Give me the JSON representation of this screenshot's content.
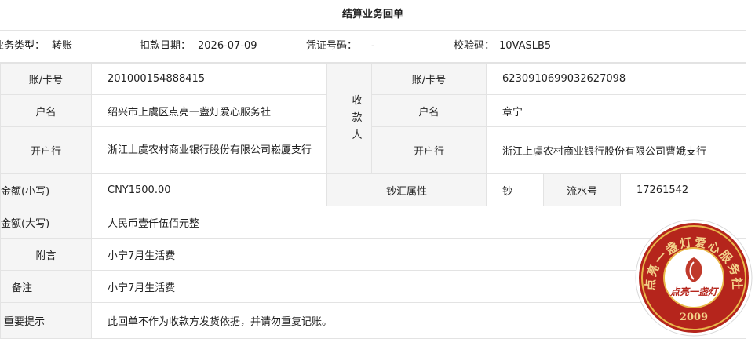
{
  "title": "结算业务回单",
  "meta": {
    "type_label": "业务类型：",
    "type_value": "转账",
    "date_label": "扣款日期：",
    "date_value": "2026-07-09",
    "voucher_label": "凭证号码：",
    "voucher_value": "-",
    "check_label": "校验码：",
    "check_value": "10VASLB5"
  },
  "payer": {
    "account_label": "账/卡号",
    "account_value": "201000154888415",
    "name_label": "户名",
    "name_value": "绍兴市上虞区点亮一盏灯爱心服务社",
    "bank_label": "开户行",
    "bank_value": "浙江上虞农村商业银行股份有限公司崧厦支行"
  },
  "payee": {
    "side_label": "收款人",
    "account_label": "账/卡号",
    "account_value": "6230910699032627098",
    "name_label": "户名",
    "name_value": "章宁",
    "bank_label": "开户行",
    "bank_value": "浙江上虞农村商业银行股份有限公司曹娥支行"
  },
  "amount": {
    "small_label": "金额(小写)",
    "small_value": "CNY1500.00",
    "fx_label": "钞汇属性",
    "fx_value": "钞",
    "serial_label": "流水号",
    "serial_value": "17261542",
    "big_label": "金额(大写)",
    "big_value": "人民币壹仟伍佰元整"
  },
  "remarks": {
    "postscript_label": "附言",
    "postscript_value": "小宁7月生活费",
    "note_label": "备注",
    "note_value": "小宁7月生活费",
    "important_label": "重要提示",
    "important_value": "此回单不作为收款方发货依据，并请勿重复记账。"
  },
  "seal": {
    "ring_text": "点亮一盏灯爱心服务社",
    "center_text": "点亮一盏灯",
    "year": "2009",
    "color": "#a8201a",
    "gold": "#e9b94a"
  }
}
